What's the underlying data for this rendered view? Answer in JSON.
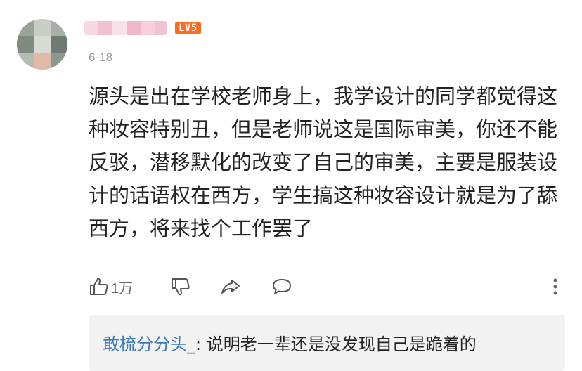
{
  "comment": {
    "level_badge": "LV5",
    "date": "6-18",
    "text": "源头是出在学校老师身上，我学设计的同学都觉得这种妆容特别丑，但是老师说这是国际审美，你还不能反驳，潜移默化的改变了自己的审美，主要是服装设计的话语权在西方，学生搞这种妆容设计就是为了舔西方，将来找个工作罢了",
    "like_count": "1万"
  },
  "actions": {
    "like_icon": "thumbs-up-icon",
    "dislike_icon": "thumbs-down-icon",
    "share_icon": "share-icon",
    "reply_icon": "comment-bubble-icon",
    "more_icon": "more-vertical-icon"
  },
  "reply": {
    "author": "敢梳分分头_",
    "separator": ": ",
    "text": "说明老一辈还是没发现自己是跪着的"
  },
  "colors": {
    "level_badge": "#ff6a1f",
    "reply_author": "#3b78b8",
    "reply_background": "#f2f2f2",
    "meta_gray": "#9a9a9a"
  }
}
